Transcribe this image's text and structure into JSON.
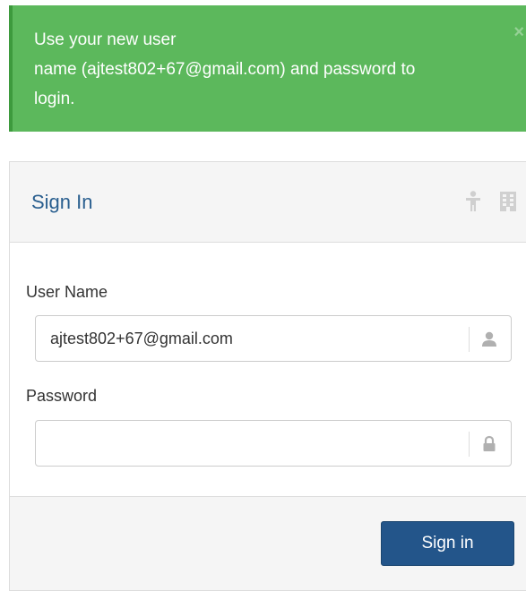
{
  "alert": {
    "line1": "Use your new user",
    "line2": "name (ajtest802+67@gmail.com) and password to",
    "line3": "login.",
    "close": "×"
  },
  "panel": {
    "title": "Sign In",
    "icons": [
      "person-icon",
      "building-icon"
    ]
  },
  "form": {
    "username_label": "User Name",
    "username_value": "ajtest802+67@gmail.com",
    "username_icon": "user-icon",
    "password_label": "Password",
    "password_value": "",
    "password_icon": "lock-icon"
  },
  "footer": {
    "sign_in_label": "Sign in"
  },
  "colors": {
    "alert_bg": "#5cb85c",
    "title": "#2a5f8f",
    "button": "#23558a"
  }
}
